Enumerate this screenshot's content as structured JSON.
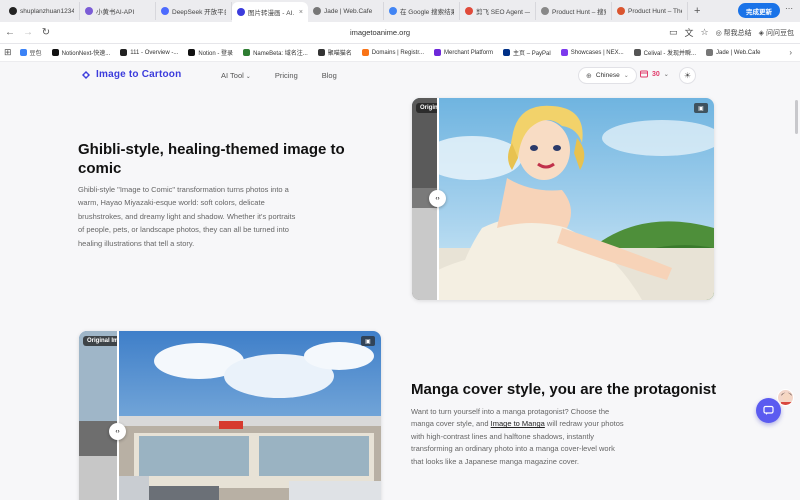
{
  "browser": {
    "tabs": [
      {
        "label": "shuplanzhuan1234...",
        "color": "#222222"
      },
      {
        "label": "小黄书AI-API",
        "color": "#7b5cd6"
      },
      {
        "label": "DeepSeek 开放平台",
        "color": "#4d6bfe"
      },
      {
        "label": "图片转漫画 - AI...",
        "color": "#3b3bdc",
        "active": true
      },
      {
        "label": "Jade | Web.Cafe",
        "color": "#777777"
      },
      {
        "label": "在 Google 搜索结果...",
        "color": "#4285f4"
      },
      {
        "label": "剪飞 SEO Agent —...",
        "color": "#e04a3a"
      },
      {
        "label": "Product Hunt – 搜索",
        "color": "#888888"
      },
      {
        "label": "Product Hunt – The...",
        "color": "#da552f"
      }
    ],
    "update_button": "完成更新",
    "url": "imagetoanime.org",
    "toolbar_right": {
      "item1": "帮我总结",
      "item2": "问问豆包"
    },
    "bookmarks": [
      {
        "label": "豆包",
        "color": "#3b82f6"
      },
      {
        "label": "NotionNext-快速...",
        "color": "#111111"
      },
      {
        "label": "111 - Overview -...",
        "color": "#222222"
      },
      {
        "label": "Notion - 登录",
        "color": "#111111"
      },
      {
        "label": "NameBeta: 域名注...",
        "color": "#2e7d32"
      },
      {
        "label": "聚喵猫名",
        "color": "#333333"
      },
      {
        "label": "Domains | Registr...",
        "color": "#f97316"
      },
      {
        "label": "Merchant Platform",
        "color": "#6d28d9"
      },
      {
        "label": "主页 – PayPal",
        "color": "#003087"
      },
      {
        "label": "Showcases | NEX...",
        "color": "#7c3aed"
      },
      {
        "label": "Celival - 发现并瞬...",
        "color": "#555555"
      },
      {
        "label": "Jade | Web.Cafe",
        "color": "#777777"
      }
    ]
  },
  "site": {
    "logo_text": "Image to Cartoon",
    "nav": {
      "ai_tool": "AI Tool",
      "pricing": "Pricing",
      "blog": "Blog"
    },
    "language": "Chinese",
    "credits": "30",
    "accent": "#3b3bdc"
  },
  "section1": {
    "title": "Ghibli-style, healing-themed image to comic",
    "description": "Ghibli-style \"Image to Comic\" transformation turns photos into a warm, Hayao Miyazaki-esque world: soft colors, delicate brushstrokes, and dreamy light and shadow. Whether it's portraits of people, pets, or landscape photos, they can all be turned into healing illustrations that tell a story.",
    "badge": "Original"
  },
  "section2": {
    "title": "Manga cover style, you are the protagonist",
    "desc_part1": "Want to turn yourself into a manga protagonist? Choose the manga cover style, and ",
    "desc_link": "Image to Manga",
    "desc_part2": " will redraw your photos with high-contrast lines and halftone shadows, instantly transforming an ordinary photo into a manga cover-level work that looks like a Japanese manga magazine cover.",
    "badge": "Original Im"
  }
}
